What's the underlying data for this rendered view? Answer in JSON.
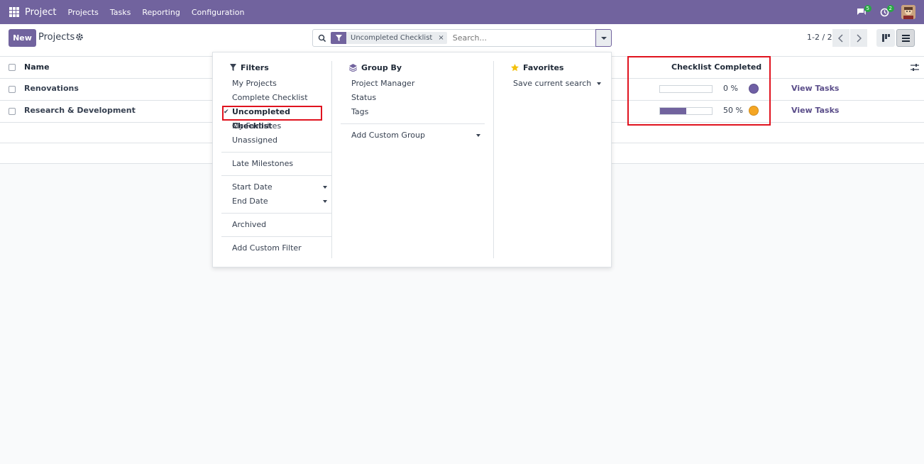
{
  "navbar": {
    "brand": "Project",
    "menu": [
      "Projects",
      "Tasks",
      "Reporting",
      "Configuration"
    ],
    "messages_badge": "5",
    "activities_badge": "2",
    "color": "#71639e"
  },
  "control": {
    "new_label": "New",
    "breadcrumb": "Projects",
    "facet_label": "Uncompleted Checklist",
    "facet_close": "×",
    "search_placeholder": "Search...",
    "pager": "1-2 / 2"
  },
  "table": {
    "headers": {
      "name": "Name",
      "checklist": "Checklist Completed"
    },
    "rows": [
      {
        "name": "Renovations",
        "progress": 0,
        "percent": "0 %",
        "status_color": "#6f5fa5",
        "action": "View Tasks"
      },
      {
        "name": "Research & Development",
        "progress": 50,
        "percent": "50 %",
        "status_color": "#f5a623",
        "action": "View Tasks"
      }
    ]
  },
  "dropdown": {
    "filters": {
      "title": "Filters",
      "group1": [
        "My Projects",
        "Complete Checklist",
        "Uncompleted Checklist",
        "My Favorites",
        "Unassigned"
      ],
      "group2": [
        "Late Milestones"
      ],
      "group3": [
        "Start Date",
        "End Date"
      ],
      "group4": [
        "Archived"
      ],
      "group5": [
        "Add Custom Filter"
      ]
    },
    "groupby": {
      "title": "Group By",
      "items": [
        "Project Manager",
        "Status",
        "Tags"
      ],
      "custom": "Add Custom Group"
    },
    "favorites": {
      "title": "Favorites",
      "items": [
        "Save current search"
      ]
    }
  }
}
